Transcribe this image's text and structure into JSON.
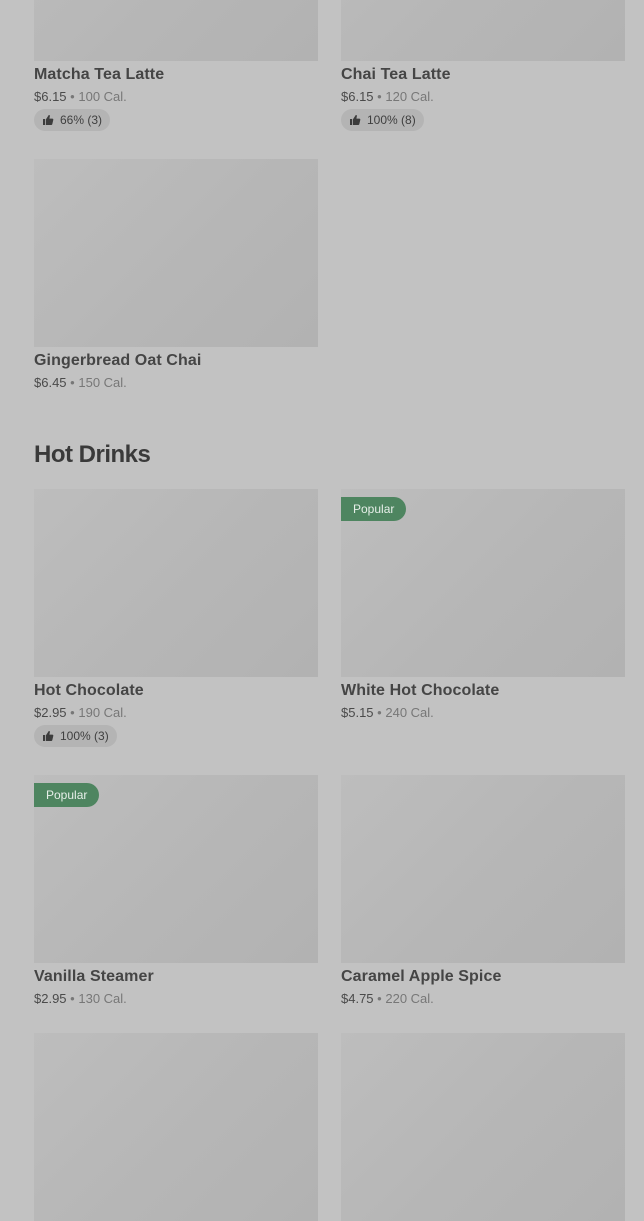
{
  "tea_section": {
    "items": [
      {
        "name": "Matcha Tea Latte",
        "price": "$6.15",
        "calories": "100 Cal.",
        "rating": "66% (3)"
      },
      {
        "name": "Chai Tea Latte",
        "price": "$6.15",
        "calories": "120 Cal.",
        "rating": "100% (8)"
      },
      {
        "name": "Gingerbread Oat Chai",
        "price": "$6.45",
        "calories": "150 Cal."
      }
    ]
  },
  "hot_drinks": {
    "title": "Hot Drinks",
    "items": [
      {
        "name": "Hot Chocolate",
        "price": "$2.95",
        "calories": "190 Cal.",
        "rating": "100% (3)"
      },
      {
        "name": "White Hot Chocolate",
        "price": "$5.15",
        "calories": "240 Cal.",
        "badge": "Popular"
      },
      {
        "name": "Vanilla Steamer",
        "price": "$2.95",
        "calories": "130 Cal.",
        "badge": "Popular"
      },
      {
        "name": "Caramel Apple Spice",
        "price": "$4.75",
        "calories": "220 Cal."
      }
    ]
  },
  "separator": "•",
  "icons": {
    "rating": "thumbs-up-icon"
  },
  "colors": {
    "background": "#c2c2c2",
    "badge": "#4e8560",
    "image_placeholder": "#b8b8b8",
    "rating_pill": "#b4b4b4"
  }
}
